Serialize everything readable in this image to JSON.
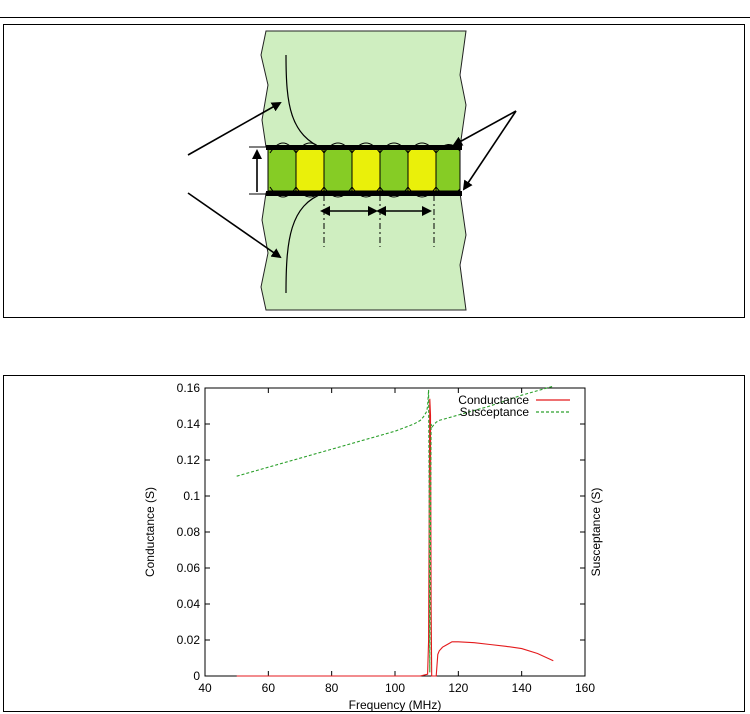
{
  "chart_data": {
    "type": "line",
    "title": "",
    "xlabel": "Frequency (MHz)",
    "ylabel": "Conductance (S)",
    "y2label": "Susceptance (S)",
    "xlim": [
      40,
      160
    ],
    "ylim": [
      0,
      0.16
    ],
    "xticks": [
      "40",
      "60",
      "80",
      "100",
      "120",
      "140",
      "160"
    ],
    "yticks": [
      "0",
      "0.02",
      "0.04",
      "0.06",
      "0.08",
      "0.1",
      "0.12",
      "0.14",
      "0.16"
    ],
    "legend_position": "top-right",
    "grid": false,
    "series": [
      {
        "name": "Conductance",
        "color": "#e41a1c",
        "style": "solid",
        "x": [
          50,
          108,
          110.3,
          110.6,
          110.8,
          111.0,
          111.2,
          111.4,
          111.6,
          112.0,
          113.0,
          113.5,
          114,
          115,
          116,
          117,
          118,
          120,
          125,
          130,
          135,
          140,
          145,
          150
        ],
        "y": [
          0,
          0,
          0.001,
          0.02,
          0.09,
          0.154,
          0.145,
          0.04,
          0,
          0,
          0,
          0.012,
          0.014,
          0.016,
          0.017,
          0.018,
          0.019,
          0.019,
          0.0185,
          0.0175,
          0.0165,
          0.0152,
          0.0125,
          0.0085
        ]
      },
      {
        "name": "Susceptance",
        "color": "#2ca02c",
        "style": "dashed",
        "x": [
          50,
          60,
          70,
          80,
          90,
          100,
          106,
          108,
          109,
          110,
          110.3,
          110.6,
          110.8,
          111.0,
          111.2,
          111.4,
          111.6,
          112,
          113,
          114,
          116,
          120,
          130,
          140,
          150
        ],
        "y": [
          0.111,
          0.116,
          0.121,
          0.126,
          0.131,
          0.136,
          0.14,
          0.142,
          0.144,
          0.147,
          0.15,
          0.159,
          0.1,
          0.002,
          0.08,
          0.14,
          0.138,
          0.139,
          0.141,
          0.142,
          0.143,
          0.145,
          0.15,
          0.156,
          0.161
        ]
      }
    ]
  }
}
